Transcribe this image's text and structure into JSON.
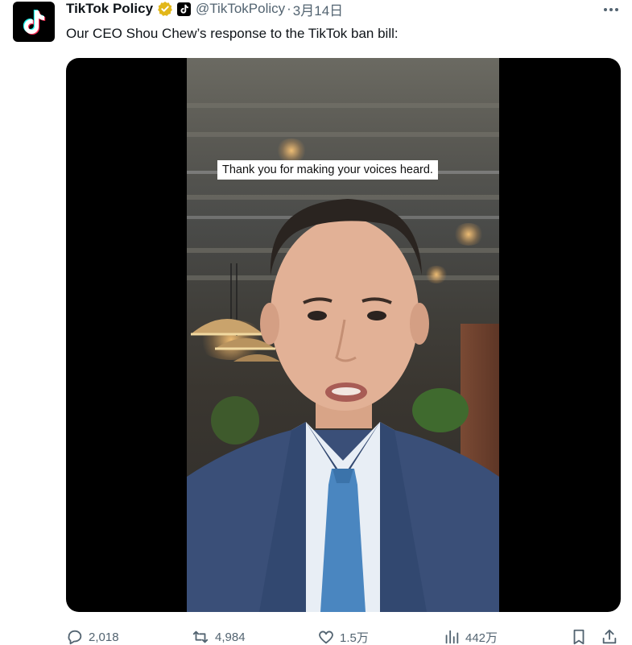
{
  "account": {
    "display_name": "TikTok Policy",
    "handle": "@TikTokPolicy",
    "separator": "·",
    "date": "3月14日",
    "verified_color": "#e2b719"
  },
  "tweet": {
    "text": "Our CEO Shou Chew’s response to the TikTok ban bill:"
  },
  "media": {
    "caption": "Thank you for making your voices heard."
  },
  "actions": {
    "reply_count": "2,018",
    "retweet_count": "4,984",
    "like_count": "1.5万",
    "view_count": "442万"
  },
  "icons": [
    "tiktok-logo-icon",
    "verified-badge-icon",
    "tiktok-affiliate-icon",
    "more-icon",
    "reply-icon",
    "retweet-icon",
    "like-icon",
    "views-icon",
    "bookmark-icon",
    "share-icon"
  ]
}
